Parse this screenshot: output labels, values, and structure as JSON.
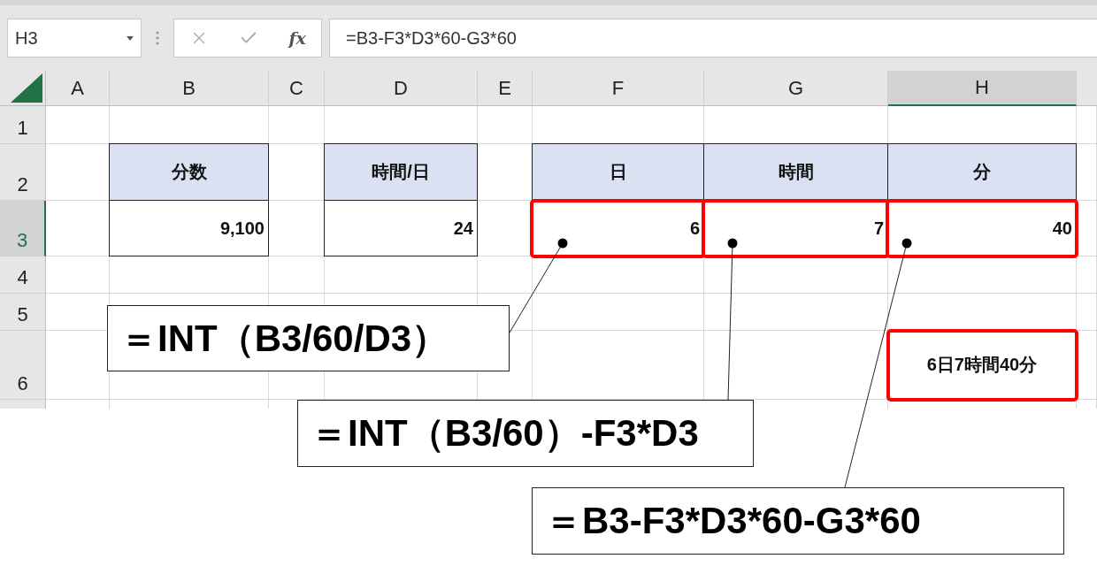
{
  "name_box": "H3",
  "fx_label": "fx",
  "formula": "=B3-F3*D3*60-G3*60",
  "columns": [
    {
      "label": "A",
      "selected": false
    },
    {
      "label": "B",
      "selected": false
    },
    {
      "label": "C",
      "selected": false
    },
    {
      "label": "D",
      "selected": false
    },
    {
      "label": "E",
      "selected": false
    },
    {
      "label": "F",
      "selected": false
    },
    {
      "label": "G",
      "selected": false
    },
    {
      "label": "H",
      "selected": true
    }
  ],
  "rows": [
    {
      "label": "1",
      "selected": false,
      "cells": [
        {
          "kind": "blank"
        },
        {
          "kind": "blank"
        },
        {
          "kind": "blank"
        },
        {
          "kind": "blank"
        },
        {
          "kind": "blank"
        },
        {
          "kind": "blank"
        },
        {
          "kind": "blank"
        },
        {
          "kind": "blank"
        }
      ]
    },
    {
      "label": "2",
      "selected": false,
      "cells": [
        {
          "kind": "blank"
        },
        {
          "kind": "header",
          "text": "分数"
        },
        {
          "kind": "blank"
        },
        {
          "kind": "header",
          "text": "時間/日"
        },
        {
          "kind": "blank"
        },
        {
          "kind": "header",
          "text": "日"
        },
        {
          "kind": "header",
          "text": "時間"
        },
        {
          "kind": "header",
          "text": "分"
        }
      ]
    },
    {
      "label": "3",
      "selected": true,
      "cells": [
        {
          "kind": "blank"
        },
        {
          "kind": "value",
          "text": "9,100",
          "highlighted": false
        },
        {
          "kind": "blank"
        },
        {
          "kind": "value",
          "text": "24",
          "highlighted": false
        },
        {
          "kind": "blank"
        },
        {
          "kind": "value",
          "text": "6",
          "highlighted": true
        },
        {
          "kind": "value",
          "text": "7",
          "highlighted": true
        },
        {
          "kind": "value",
          "text": "40",
          "highlighted": true
        }
      ]
    },
    {
      "label": "4",
      "selected": false,
      "cells": [
        {
          "kind": "blank"
        },
        {
          "kind": "blank"
        },
        {
          "kind": "blank"
        },
        {
          "kind": "blank"
        },
        {
          "kind": "blank"
        },
        {
          "kind": "blank"
        },
        {
          "kind": "blank"
        },
        {
          "kind": "blank"
        }
      ]
    },
    {
      "label": "5",
      "selected": false,
      "cells": [
        {
          "kind": "blank"
        },
        {
          "kind": "blank"
        },
        {
          "kind": "blank"
        },
        {
          "kind": "blank"
        },
        {
          "kind": "blank"
        },
        {
          "kind": "blank"
        },
        {
          "kind": "blank"
        },
        {
          "kind": "blank"
        }
      ]
    },
    {
      "label": "6",
      "selected": false,
      "cells": [
        {
          "kind": "blank"
        },
        {
          "kind": "blank"
        },
        {
          "kind": "blank"
        },
        {
          "kind": "blank"
        },
        {
          "kind": "blank"
        },
        {
          "kind": "blank"
        },
        {
          "kind": "blank"
        },
        {
          "kind": "result",
          "text": "6日7時間40分",
          "highlighted": true
        }
      ]
    }
  ],
  "callouts": [
    {
      "text": "＝INT（B3/60/D3）"
    },
    {
      "text": "＝INT（B3/60）-F3*D3"
    },
    {
      "text": "＝B3-F3*D3*60-G3*60"
    }
  ]
}
